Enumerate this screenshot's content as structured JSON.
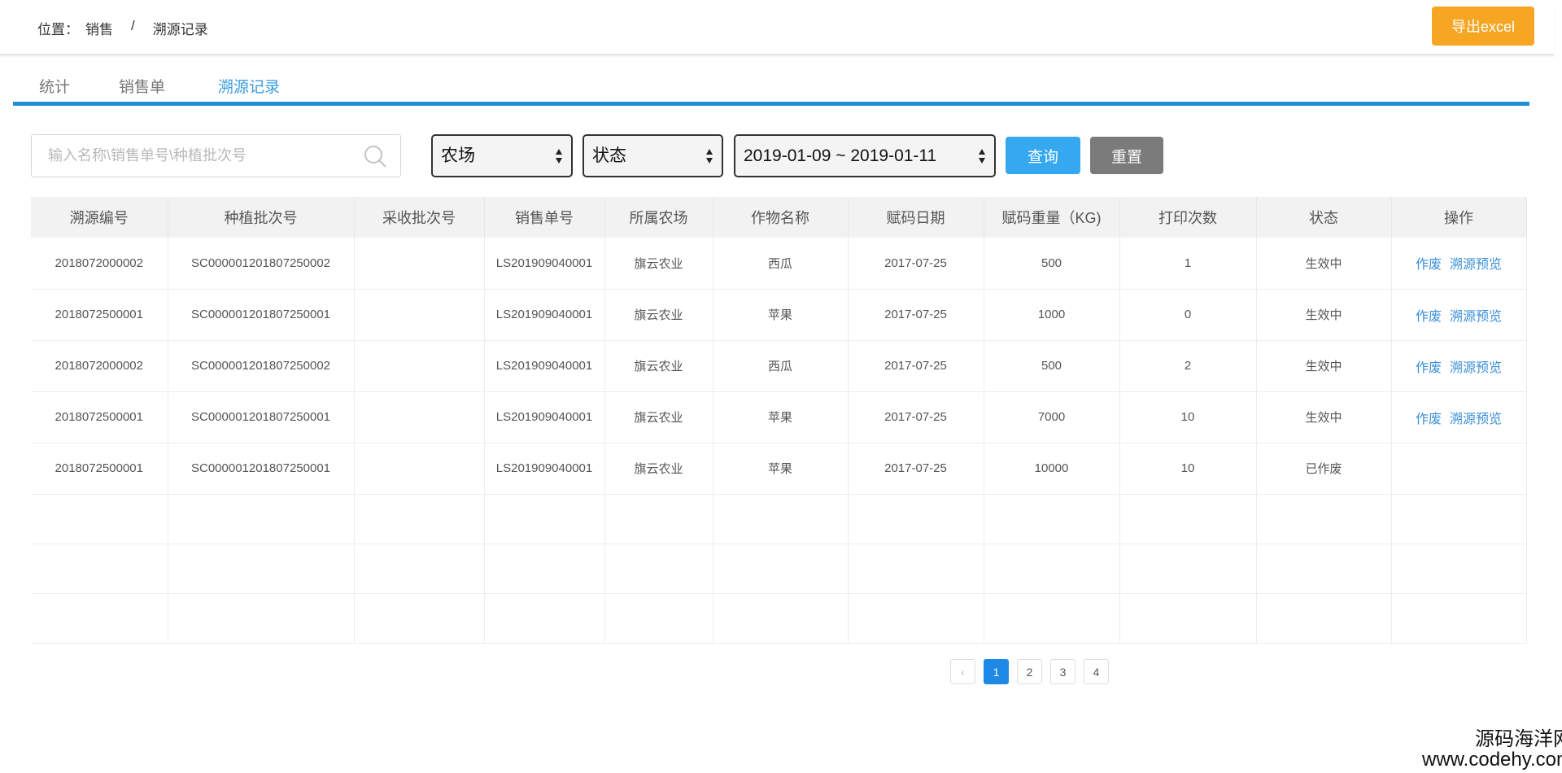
{
  "header": {
    "breadcrumb_label": "位置：",
    "breadcrumb_section": "销售",
    "breadcrumb_sep": "/",
    "breadcrumb_current": "溯源记录",
    "export_label": "导出excel"
  },
  "tabs": [
    {
      "label": "统计",
      "active": false
    },
    {
      "label": "销售单",
      "active": false
    },
    {
      "label": "溯源记录",
      "active": true
    }
  ],
  "filters": {
    "search_placeholder": "输入名称\\销售单号\\种植批次号",
    "farm_select": "农场",
    "status_select": "状态",
    "date_range": "2019-01-09 ~ 2019-01-11",
    "query_label": "查询",
    "reset_label": "重置"
  },
  "table": {
    "columns": [
      "溯源编号",
      "种植批次号",
      "采收批次号",
      "销售单号",
      "所属农场",
      "作物名称",
      "赋码日期",
      "赋码重量（KG)",
      "打印次数",
      "状态",
      "操作"
    ],
    "rows": [
      {
        "trace_no": "2018072000002",
        "plant_batch": "SC000001201807250002",
        "harvest_batch": "",
        "sale_no": "LS201909040001",
        "farm": "旗云农业",
        "crop": "西瓜",
        "date": "2017-07-25",
        "weight": "500",
        "prints": "1",
        "status": "生效中",
        "op_void": "作废",
        "op_preview": "溯源预览"
      },
      {
        "trace_no": "2018072500001",
        "plant_batch": "SC000001201807250001",
        "harvest_batch": "",
        "sale_no": "LS201909040001",
        "farm": "旗云农业",
        "crop": "苹果",
        "date": "2017-07-25",
        "weight": "1000",
        "prints": "0",
        "status": "生效中",
        "op_void": "作废",
        "op_preview": "溯源预览"
      },
      {
        "trace_no": "2018072000002",
        "plant_batch": "SC000001201807250002",
        "harvest_batch": "",
        "sale_no": "LS201909040001",
        "farm": "旗云农业",
        "crop": "西瓜",
        "date": "2017-07-25",
        "weight": "500",
        "prints": "2",
        "status": "生效中",
        "op_void": "作废",
        "op_preview": "溯源预览"
      },
      {
        "trace_no": "2018072500001",
        "plant_batch": "SC000001201807250001",
        "harvest_batch": "",
        "sale_no": "LS201909040001",
        "farm": "旗云农业",
        "crop": "苹果",
        "date": "2017-07-25",
        "weight": "7000",
        "prints": "10",
        "status": "生效中",
        "op_void": "作废",
        "op_preview": "溯源预览"
      },
      {
        "trace_no": "2018072500001",
        "plant_batch": "SC000001201807250001",
        "harvest_batch": "",
        "sale_no": "LS201909040001",
        "farm": "旗云农业",
        "crop": "苹果",
        "date": "2017-07-25",
        "weight": "10000",
        "prints": "10",
        "status": "已作废",
        "op_void": "",
        "op_preview": ""
      }
    ]
  },
  "pagination": {
    "prev": "‹",
    "pages": [
      "1",
      "2",
      "3",
      "4"
    ],
    "current": "1"
  },
  "watermark": {
    "cn": "源码海洋网",
    "en": "www.codehy.com"
  },
  "colors": {
    "accent": "#1f8fdb",
    "export": "#f7a623",
    "query": "#36a8f0",
    "reset": "#7b7b7b",
    "link": "#3a8fd8"
  }
}
